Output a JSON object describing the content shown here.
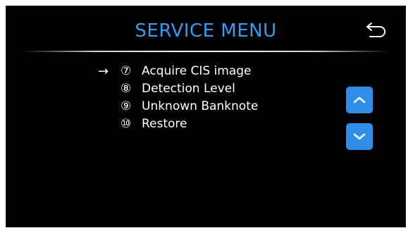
{
  "header": {
    "title": "SERVICE MENU",
    "back_icon": "undo-arrow-icon"
  },
  "menu": {
    "selected_indicator": "→",
    "items": [
      {
        "number": "⑦",
        "label": "Acquire CIS image"
      },
      {
        "number": "⑧",
        "label": "Detection Level"
      },
      {
        "number": "⑨",
        "label": "Unknown Banknote"
      },
      {
        "number": "⑩",
        "label": "Restore"
      }
    ]
  },
  "navigation": {
    "up_icon": "chevron-up-icon",
    "down_icon": "chevron-down-icon"
  },
  "colors": {
    "title": "#2f9df0",
    "button": "#2f8fe6",
    "background": "#000000",
    "text": "#ffffff"
  }
}
